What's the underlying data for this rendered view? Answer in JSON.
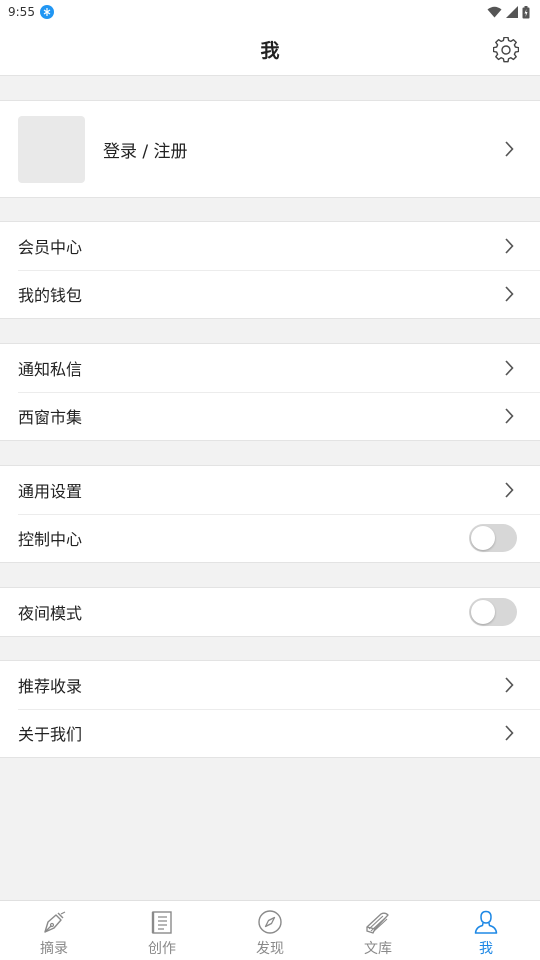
{
  "status_bar": {
    "time": "9:55"
  },
  "header": {
    "title": "我"
  },
  "profile": {
    "login_label": "登录 / 注册"
  },
  "groups": [
    {
      "items": [
        {
          "label": "会员中心"
        },
        {
          "label": "我的钱包"
        }
      ]
    },
    {
      "items": [
        {
          "label": "通知私信"
        },
        {
          "label": "西窗市集"
        }
      ]
    },
    {
      "items": [
        {
          "label": "通用设置"
        },
        {
          "label": "控制中心"
        }
      ]
    },
    {
      "items": [
        {
          "label": "夜间模式"
        }
      ]
    },
    {
      "items": [
        {
          "label": "推荐收录"
        },
        {
          "label": "关于我们"
        }
      ]
    }
  ],
  "toggles": {
    "control_center": false,
    "night_mode": false
  },
  "tabs": [
    {
      "label": "摘录",
      "icon": "pen-nib-icon",
      "active": false
    },
    {
      "label": "创作",
      "icon": "document-icon",
      "active": false
    },
    {
      "label": "发现",
      "icon": "compass-icon",
      "active": false
    },
    {
      "label": "文库",
      "icon": "books-icon",
      "active": false
    },
    {
      "label": "我",
      "icon": "person-icon",
      "active": true
    }
  ],
  "colors": {
    "accent": "#1e88e5",
    "background": "#f2f2f2",
    "inactive_tab": "#8a8a8a"
  }
}
